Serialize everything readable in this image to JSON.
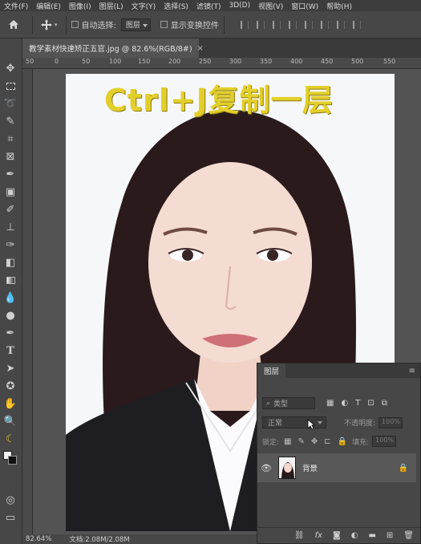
{
  "menu": {
    "items": [
      "文件(F)",
      "编辑(E)",
      "图像(I)",
      "图层(L)",
      "文字(Y)",
      "选择(S)",
      "滤镜(T)",
      "3D(D)",
      "视图(V)",
      "窗口(W)",
      "帮助(H)"
    ]
  },
  "options": {
    "auto_select_label": "自动选择:",
    "auto_select_value": "图层",
    "show_transform_label": "显示变换控件"
  },
  "document": {
    "tab_title": "教学素材快速矫正五官.jpg @ 82.6%(RGB/8#)",
    "close": "×"
  },
  "ruler": {
    "ticks": [
      "50",
      "0",
      "50",
      "100",
      "150",
      "200",
      "250",
      "300",
      "350",
      "400",
      "450",
      "500",
      "550"
    ]
  },
  "overlay": {
    "text": "Ctrl+J复制一层"
  },
  "status": {
    "zoom": "82.64%",
    "doc_info": "文档:2.08M/2.08M"
  },
  "layers_panel": {
    "title": "图层",
    "search_placeholder": "类型",
    "blend_mode": "正常",
    "opacity_label": "不透明度:",
    "opacity_value": "100%",
    "lock_label": "锁定:",
    "fill_label": "填充:",
    "fill_value": "100%",
    "layer_name": "背景"
  },
  "colors": {
    "overlay_text": "#e3cf2a",
    "panel_bg": "#474747",
    "workspace_bg": "#535353"
  }
}
